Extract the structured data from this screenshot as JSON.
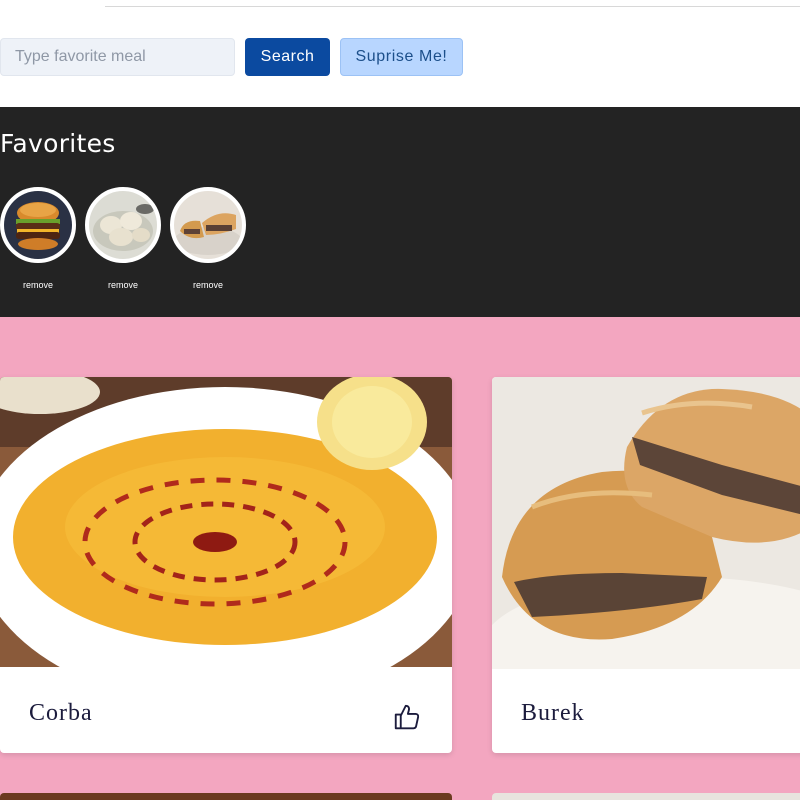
{
  "search": {
    "placeholder": "Type favorite meal",
    "value": ""
  },
  "buttons": {
    "search": "Search",
    "surprise": "Suprise Me!"
  },
  "favorites": {
    "title": "Favorites",
    "items": [
      {
        "meal": "burger",
        "remove_label": "remove"
      },
      {
        "meal": "dumplings",
        "remove_label": "remove"
      },
      {
        "meal": "burek",
        "remove_label": "remove"
      }
    ]
  },
  "meals": [
    {
      "name": "Corba",
      "icon": "thumbs-up-icon"
    },
    {
      "name": "Burek",
      "icon": "thumbs-up-icon"
    }
  ],
  "colors": {
    "page_background": "#f3a6c0",
    "favorites_background": "#232323",
    "search_button": "#0b4aa0",
    "surprise_button": "#b8d6ff"
  }
}
